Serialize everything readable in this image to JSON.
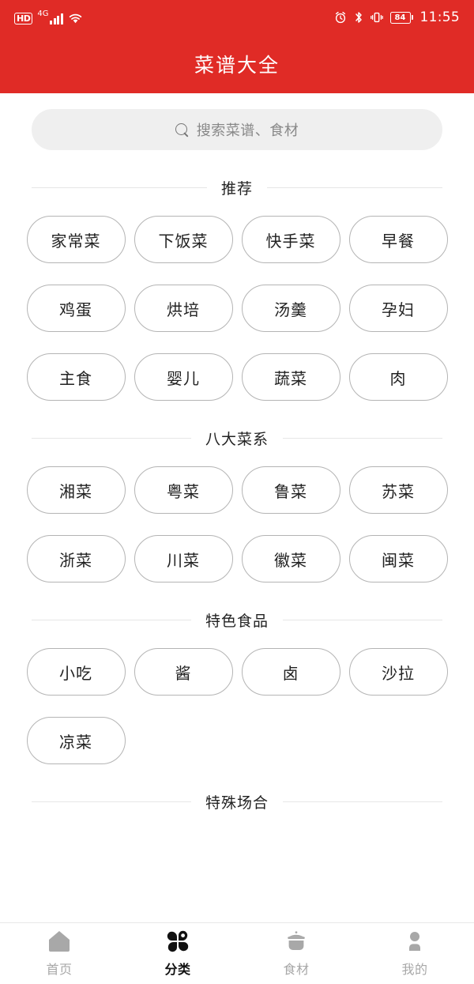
{
  "status_bar": {
    "hd_label": "HD",
    "network_type": "4G",
    "signal_icon": "signal-bars-icon",
    "wifi_icon": "wifi-icon",
    "alarm_icon": "alarm-clock-icon",
    "bluetooth_icon": "bluetooth-icon",
    "vibrate_icon": "vibrate-mode-icon",
    "battery_icon": "battery-icon",
    "battery_level": "84",
    "time": "11:55"
  },
  "app_bar": {
    "title": "菜谱大全",
    "background_color": "#e02b26"
  },
  "search": {
    "icon": "search-icon",
    "placeholder": "搜索菜谱、食材",
    "value": ""
  },
  "sections": [
    {
      "title": "推荐",
      "chips": [
        "家常菜",
        "下饭菜",
        "快手菜",
        "早餐",
        "鸡蛋",
        "烘培",
        "汤羹",
        "孕妇",
        "主食",
        "婴儿",
        "蔬菜",
        "肉"
      ]
    },
    {
      "title": "八大菜系",
      "chips": [
        "湘菜",
        "粤菜",
        "鲁菜",
        "苏菜",
        "浙菜",
        "川菜",
        "徽菜",
        "闽菜"
      ]
    },
    {
      "title": "特色食品",
      "chips": [
        "小吃",
        "酱",
        "卤",
        "沙拉",
        "凉菜"
      ]
    },
    {
      "title": "特殊场合",
      "chips": []
    }
  ],
  "tab_bar": {
    "items": [
      {
        "label": "首页",
        "icon": "home-icon",
        "active": false
      },
      {
        "label": "分类",
        "icon": "categories-clover-icon",
        "active": true
      },
      {
        "label": "食材",
        "icon": "cooking-pot-icon",
        "active": false
      },
      {
        "label": "我的",
        "icon": "person-icon",
        "active": false
      }
    ],
    "active_color": "#111111",
    "inactive_color": "#a8a8a8"
  }
}
